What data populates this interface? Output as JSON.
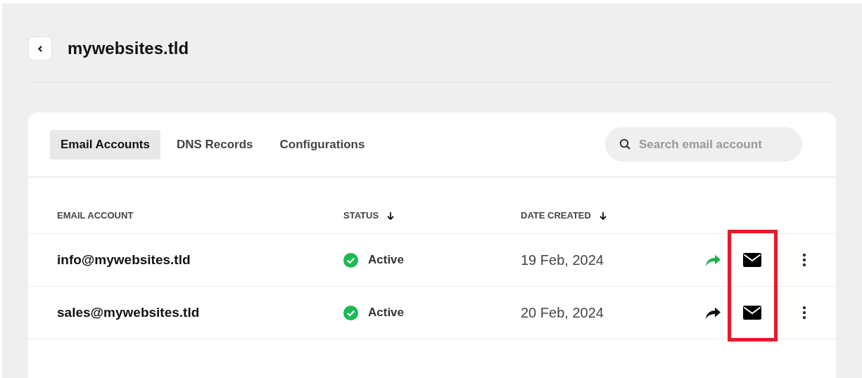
{
  "header": {
    "title": "mywebsites.tld"
  },
  "tabs": [
    {
      "label": "Email Accounts",
      "selected": true
    },
    {
      "label": "DNS Records",
      "selected": false
    },
    {
      "label": "Configurations",
      "selected": false
    }
  ],
  "search": {
    "placeholder": "Search email account"
  },
  "table": {
    "columns": [
      {
        "label": "EMAIL ACCOUNT",
        "sortable": false
      },
      {
        "label": "STATUS",
        "sortable": true
      },
      {
        "label": "DATE CREATED",
        "sortable": true
      }
    ],
    "rows": [
      {
        "email": "info@mywebsites.tld",
        "status": "Active",
        "active": true,
        "date": "19 Feb, 2024",
        "forwarding": true
      },
      {
        "email": "sales@mywebsites.tld",
        "status": "Active",
        "active": true,
        "date": "20 Feb, 2024",
        "forwarding": false
      }
    ]
  },
  "mail_column_highlighted": true
}
